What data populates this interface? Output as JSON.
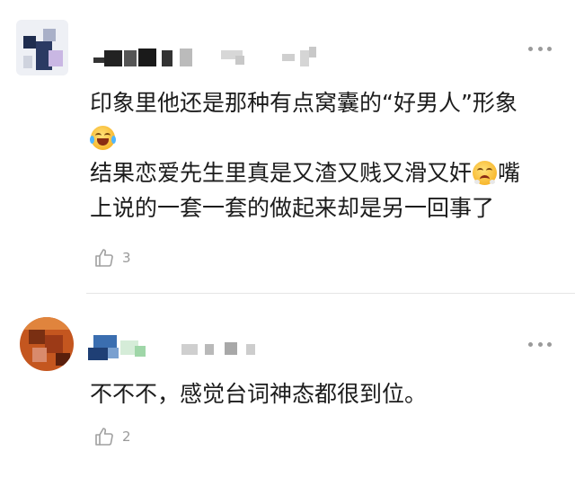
{
  "comments": [
    {
      "lines": [
        "印象里他还是那种有点窝囊的“好男人”形象",
        "",
        "结果恋爱先生里真是又渣又贱又滑又奸",
        "上说的一套一套的做起来却是另一回事了"
      ],
      "line3_tail": "嘴",
      "emoji_1": "tears-of-joy-emoji",
      "emoji_2": "steam-from-nose-emoji",
      "likes": "3"
    },
    {
      "lines": [
        "不不不，感觉台词神态都很到位。"
      ],
      "likes": "2"
    }
  ],
  "icons": {
    "like": "thumbs-up-icon",
    "more": "more-dots-icon"
  }
}
